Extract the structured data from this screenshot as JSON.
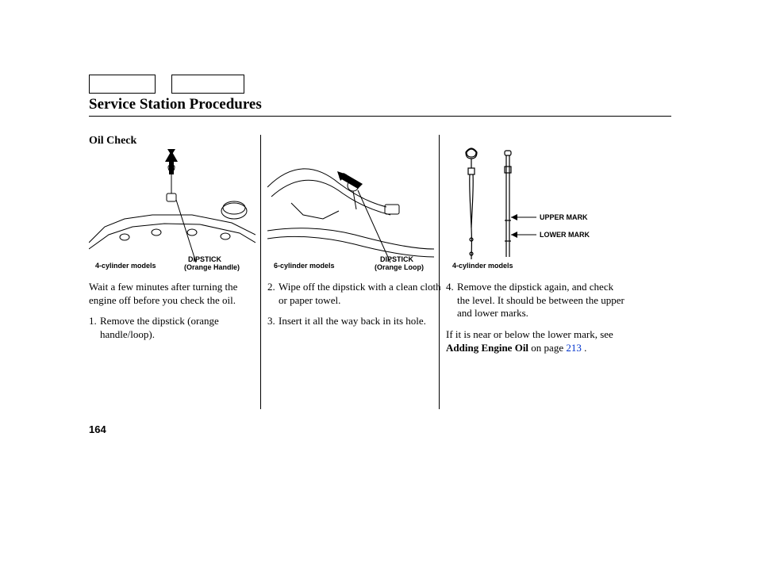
{
  "title": "Service Station Procedures",
  "subhead": "Oil Check",
  "page_number": "164",
  "fig1": {
    "model_label": "4-cylinder models",
    "callout_1": "DIPSTICK",
    "callout_2": "(Orange Handle)"
  },
  "fig2": {
    "model_label": "6-cylinder models",
    "callout_1": "DIPSTICK",
    "callout_2": "(Orange Loop)"
  },
  "fig3": {
    "model_label": "4-cylinder models",
    "callout_upper": "UPPER MARK",
    "callout_lower": "LOWER MARK"
  },
  "col1": {
    "intro": "Wait a few minutes after turning the engine off before you check the oil.",
    "step1_num": "1.",
    "step1": "Remove the dipstick (orange handle/loop)."
  },
  "col2": {
    "step2_num": "2.",
    "step2": "Wipe off the dipstick with a clean cloth or paper towel.",
    "step3_num": "3.",
    "step3": "Insert it all the way back in its hole."
  },
  "col3": {
    "step4_num": "4.",
    "step4": "Remove the dipstick again, and check the level. It should be between the upper and lower marks.",
    "p2_pre": "If it is near or below the lower mark, see ",
    "p2_bold": "Adding Engine Oil",
    "p2_mid": " on page ",
    "p2_pagelink": "213",
    "p2_post": " ."
  }
}
